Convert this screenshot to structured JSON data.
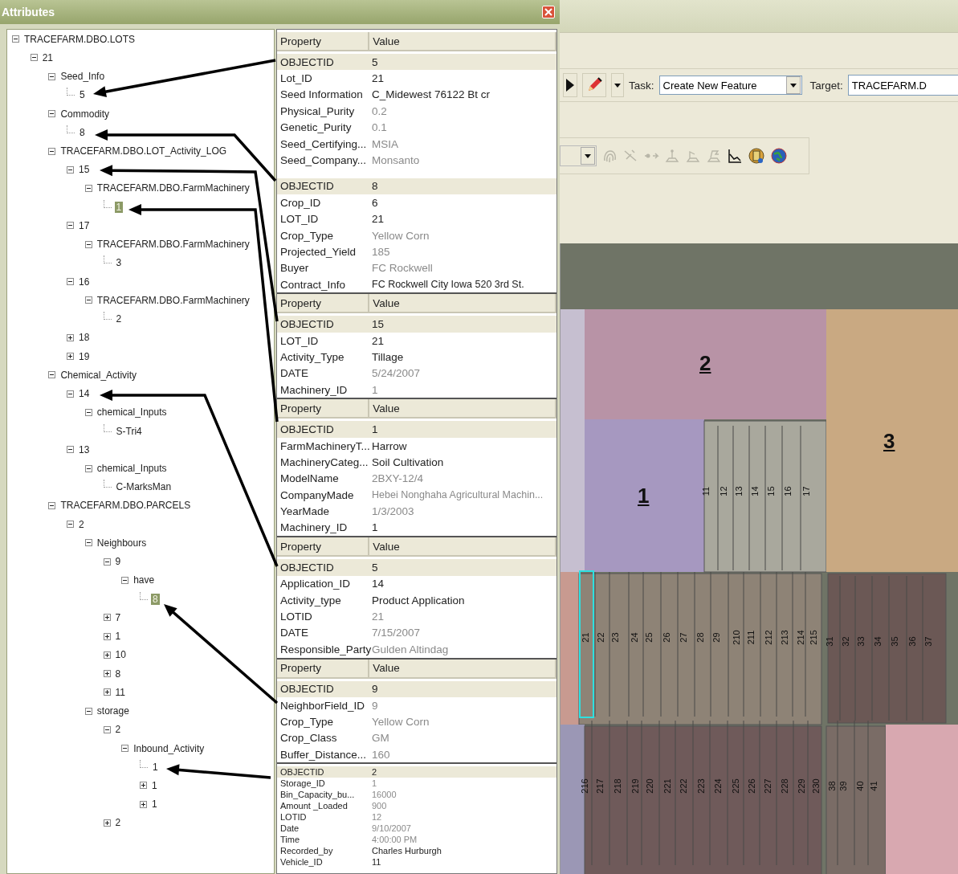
{
  "window": {
    "title": "Attributes"
  },
  "tree": [
    {
      "label": "TRACEFARM.DBO.LOTS",
      "expanded": true,
      "selected": false,
      "children": [
        {
          "label": "21",
          "expanded": true,
          "selected": false,
          "children": [
            {
              "label": "Seed_Info",
              "expanded": true,
              "selected": false,
              "children": [
                {
                  "label": "5",
                  "selected": false
                }
              ]
            },
            {
              "label": "Commodity",
              "expanded": true,
              "selected": false,
              "children": [
                {
                  "label": "8",
                  "selected": false
                }
              ]
            },
            {
              "label": "TRACEFARM.DBO.LOT_Activity_LOG",
              "expanded": true,
              "selected": false,
              "children": [
                {
                  "label": "15",
                  "expanded": true,
                  "selected": false,
                  "children": [
                    {
                      "label": "TRACEFARM.DBO.FarmMachinery",
                      "expanded": true,
                      "selected": false,
                      "children": [
                        {
                          "label": "1",
                          "selected": true
                        }
                      ]
                    }
                  ]
                },
                {
                  "label": "17",
                  "expanded": true,
                  "selected": false,
                  "children": [
                    {
                      "label": "TRACEFARM.DBO.FarmMachinery",
                      "expanded": true,
                      "selected": false,
                      "children": [
                        {
                          "label": "3",
                          "selected": false
                        }
                      ]
                    }
                  ]
                },
                {
                  "label": "16",
                  "expanded": true,
                  "selected": false,
                  "children": [
                    {
                      "label": "TRACEFARM.DBO.FarmMachinery",
                      "expanded": true,
                      "selected": false,
                      "children": [
                        {
                          "label": "2",
                          "selected": false
                        }
                      ]
                    }
                  ]
                },
                {
                  "label": "18",
                  "expanded": false,
                  "selected": false
                },
                {
                  "label": "19",
                  "expanded": false,
                  "selected": false
                }
              ]
            },
            {
              "label": "Chemical_Activity",
              "expanded": true,
              "selected": false,
              "children": [
                {
                  "label": "14",
                  "expanded": true,
                  "selected": false,
                  "children": [
                    {
                      "label": "chemical_Inputs",
                      "expanded": true,
                      "selected": false,
                      "children": [
                        {
                          "label": "S-Tri4",
                          "selected": false
                        }
                      ]
                    }
                  ]
                },
                {
                  "label": "13",
                  "expanded": true,
                  "selected": false,
                  "children": [
                    {
                      "label": "chemical_Inputs",
                      "expanded": true,
                      "selected": false,
                      "children": [
                        {
                          "label": "C-MarksMan",
                          "selected": false
                        }
                      ]
                    }
                  ]
                }
              ]
            },
            {
              "label": "TRACEFARM.DBO.PARCELS",
              "expanded": true,
              "selected": false,
              "children": [
                {
                  "label": "2",
                  "expanded": true,
                  "selected": false,
                  "children": [
                    {
                      "label": "Neighbours",
                      "expanded": true,
                      "selected": false,
                      "children": [
                        {
                          "label": "9",
                          "expanded": true,
                          "selected": false,
                          "children": [
                            {
                              "label": "have",
                              "expanded": true,
                              "selected": false,
                              "children": [
                                {
                                  "label": "8",
                                  "selected": true
                                }
                              ]
                            }
                          ]
                        },
                        {
                          "label": "7",
                          "expanded": false,
                          "selected": false
                        },
                        {
                          "label": "1",
                          "expanded": false,
                          "selected": false
                        },
                        {
                          "label": "10",
                          "expanded": false,
                          "selected": false
                        },
                        {
                          "label": "8",
                          "expanded": false,
                          "selected": false
                        },
                        {
                          "label": "11",
                          "expanded": false,
                          "selected": false
                        }
                      ]
                    },
                    {
                      "label": "storage",
                      "expanded": true,
                      "selected": false,
                      "children": [
                        {
                          "label": "2",
                          "expanded": true,
                          "selected": false,
                          "children": [
                            {
                              "label": "Inbound_Activity",
                              "expanded": true,
                              "selected": false,
                              "children": [
                                {
                                  "label": "1",
                                  "selected": false
                                },
                                {
                                  "label": "1",
                                  "expanded": false,
                                  "selected": false
                                },
                                {
                                  "label": "1",
                                  "expanded": false,
                                  "selected": false
                                }
                              ]
                            }
                          ]
                        },
                        {
                          "label": "2",
                          "expanded": false,
                          "selected": false
                        }
                      ]
                    }
                  ]
                }
              ]
            }
          ]
        }
      ]
    }
  ],
  "property_tables": [
    {
      "columns": [
        "Property",
        "Value"
      ],
      "compact": false,
      "groups": [
        [
          {
            "property": "OBJECTID",
            "value": "5",
            "greyed": false
          },
          {
            "property": "Lot_ID",
            "value": "21",
            "greyed": false
          },
          {
            "property": "Seed Information",
            "value": "C_Midewest 76122 Bt cr",
            "greyed": false
          },
          {
            "property": "Physical_Purity",
            "value": "0.2",
            "greyed": true
          },
          {
            "property": "Genetic_Purity",
            "value": "0.1",
            "greyed": true
          },
          {
            "property": "Seed_Certifying...",
            "value": "MSIA",
            "greyed": true
          },
          {
            "property": "Seed_Company...",
            "value": "Monsanto",
            "greyed": true
          }
        ],
        [
          {
            "property": "OBJECTID",
            "value": "8",
            "greyed": false
          },
          {
            "property": "Crop_ID",
            "value": "6",
            "greyed": false
          },
          {
            "property": "LOT_ID",
            "value": "21",
            "greyed": false
          },
          {
            "property": "Crop_Type",
            "value": "Yellow Corn",
            "greyed": true
          },
          {
            "property": "Projected_Yield",
            "value": "185",
            "greyed": true
          },
          {
            "property": "Buyer",
            "value": "FC Rockwell",
            "greyed": true
          },
          {
            "property": "Contract_Info",
            "value": "FC Rockwell City Iowa 520 3rd St.",
            "greyed": false
          }
        ]
      ]
    },
    {
      "columns": [
        "Property",
        "Value"
      ],
      "compact": false,
      "groups": [
        [
          {
            "property": "OBJECTID",
            "value": "15",
            "greyed": false
          },
          {
            "property": "LOT_ID",
            "value": "21",
            "greyed": false
          },
          {
            "property": "Activity_Type",
            "value": "Tillage",
            "greyed": false
          },
          {
            "property": "DATE",
            "value": "5/24/2007",
            "greyed": true
          },
          {
            "property": "Machinery_ID",
            "value": "1",
            "greyed": true
          }
        ]
      ]
    },
    {
      "columns": [
        "Property",
        "Value"
      ],
      "compact": false,
      "groups": [
        [
          {
            "property": "OBJECTID",
            "value": "1",
            "greyed": false
          },
          {
            "property": "FarmMachineryT...",
            "value": "Harrow",
            "greyed": false
          },
          {
            "property": "MachineryCateg...",
            "value": "Soil Cultivation",
            "greyed": false
          },
          {
            "property": "ModelName",
            "value": "2BXY-12/4",
            "greyed": true
          },
          {
            "property": "CompanyMade",
            "value": "Hebei Nonghaha Agricultural Machin...",
            "greyed": true
          },
          {
            "property": "YearMade",
            "value": "1/3/2003",
            "greyed": true
          },
          {
            "property": "Machinery_ID",
            "value": "1",
            "greyed": false
          }
        ]
      ]
    },
    {
      "columns": [
        "Property",
        "Value"
      ],
      "compact": false,
      "groups": [
        [
          {
            "property": "OBJECTID",
            "value": "5",
            "greyed": false
          },
          {
            "property": "Application_ID",
            "value": "14",
            "greyed": false
          },
          {
            "property": "Activity_type",
            "value": "Product Application",
            "greyed": false
          },
          {
            "property": "LOTID",
            "value": "21",
            "greyed": true
          },
          {
            "property": "DATE",
            "value": "7/15/2007",
            "greyed": true
          },
          {
            "property": "Responsible_Party",
            "value": "Gulden Altindag",
            "greyed": true
          }
        ]
      ]
    },
    {
      "columns": [
        "Property",
        "Value"
      ],
      "compact": false,
      "groups": [
        [
          {
            "property": "OBJECTID",
            "value": "9",
            "greyed": false
          },
          {
            "property": "NeighborField_ID",
            "value": "9",
            "greyed": true
          },
          {
            "property": "Crop_Type",
            "value": "Yellow Corn",
            "greyed": true
          },
          {
            "property": "Crop_Class",
            "value": "GM",
            "greyed": true
          },
          {
            "property": "Buffer_Distance...",
            "value": "160",
            "greyed": true
          }
        ]
      ]
    },
    {
      "compact": true,
      "groups": [
        [
          {
            "property": "OBJECTID",
            "value": "2",
            "greyed": false
          },
          {
            "property": "Storage_ID",
            "value": "1",
            "greyed": true
          },
          {
            "property": "Bin_Capacity_bu...",
            "value": "16000",
            "greyed": true
          },
          {
            "property": "Amount _Loaded",
            "value": "900",
            "greyed": true
          },
          {
            "property": "LOTID",
            "value": "12",
            "greyed": true
          },
          {
            "property": "Date",
            "value": "9/10/2007",
            "greyed": true
          },
          {
            "property": "Time",
            "value": "4:00:00 PM",
            "greyed": true
          },
          {
            "property": "Recorded_by",
            "value": "Charles Hurburgh",
            "greyed": false
          },
          {
            "property": "Vehicle_ID",
            "value": "11",
            "greyed": false
          }
        ]
      ]
    }
  ],
  "editor_toolbar": {
    "task_label": "Task:",
    "task_value": "Create New Feature",
    "target_label": "Target:",
    "target_value": "TRACEFARM.D"
  },
  "map": {
    "parcels": [
      {
        "label": "2"
      },
      {
        "label": "1"
      },
      {
        "label": "3"
      }
    ],
    "strip_groups": [
      {
        "strips": [
          {
            "label": "11",
            "selected": false
          },
          {
            "label": "12",
            "selected": false
          },
          {
            "label": "13",
            "selected": false
          },
          {
            "label": "14",
            "selected": false
          },
          {
            "label": "15",
            "selected": false
          },
          {
            "label": "16",
            "selected": false
          },
          {
            "label": "17",
            "selected": false
          }
        ]
      },
      {
        "strips": [
          {
            "label": "21",
            "selected": true
          },
          {
            "label": "22",
            "selected": false
          },
          {
            "label": "23",
            "selected": false
          },
          {
            "label": "24",
            "selected": false
          },
          {
            "label": "25",
            "selected": false
          },
          {
            "label": "26",
            "selected": false
          },
          {
            "label": "27",
            "selected": false
          },
          {
            "label": "28",
            "selected": false
          },
          {
            "label": "29",
            "selected": false
          },
          {
            "label": "210",
            "selected": false
          },
          {
            "label": "211",
            "selected": false
          },
          {
            "label": "212",
            "selected": false
          },
          {
            "label": "213",
            "selected": false
          },
          {
            "label": "214",
            "selected": false
          },
          {
            "label": "215",
            "selected": false
          }
        ]
      },
      {
        "strips": [
          {
            "label": "31",
            "selected": false
          },
          {
            "label": "32",
            "selected": false
          },
          {
            "label": "33",
            "selected": false
          },
          {
            "label": "34",
            "selected": false
          },
          {
            "label": "35",
            "selected": false
          },
          {
            "label": "36",
            "selected": false
          },
          {
            "label": "37",
            "selected": false
          }
        ]
      },
      {
        "strips": [
          {
            "label": "216",
            "selected": false
          },
          {
            "label": "217",
            "selected": false
          },
          {
            "label": "218",
            "selected": false
          },
          {
            "label": "219",
            "selected": false
          },
          {
            "label": "220",
            "selected": false
          },
          {
            "label": "221",
            "selected": false
          },
          {
            "label": "222",
            "selected": false
          },
          {
            "label": "223",
            "selected": false
          },
          {
            "label": "224",
            "selected": false
          },
          {
            "label": "225",
            "selected": false
          },
          {
            "label": "226",
            "selected": false
          },
          {
            "label": "227",
            "selected": false
          },
          {
            "label": "228",
            "selected": false
          },
          {
            "label": "229",
            "selected": false
          },
          {
            "label": "230",
            "selected": false
          }
        ]
      },
      {
        "strips": [
          {
            "label": "38",
            "selected": false
          },
          {
            "label": "39",
            "selected": false
          },
          {
            "label": "40",
            "selected": false
          },
          {
            "label": "41",
            "selected": false
          }
        ]
      }
    ]
  }
}
